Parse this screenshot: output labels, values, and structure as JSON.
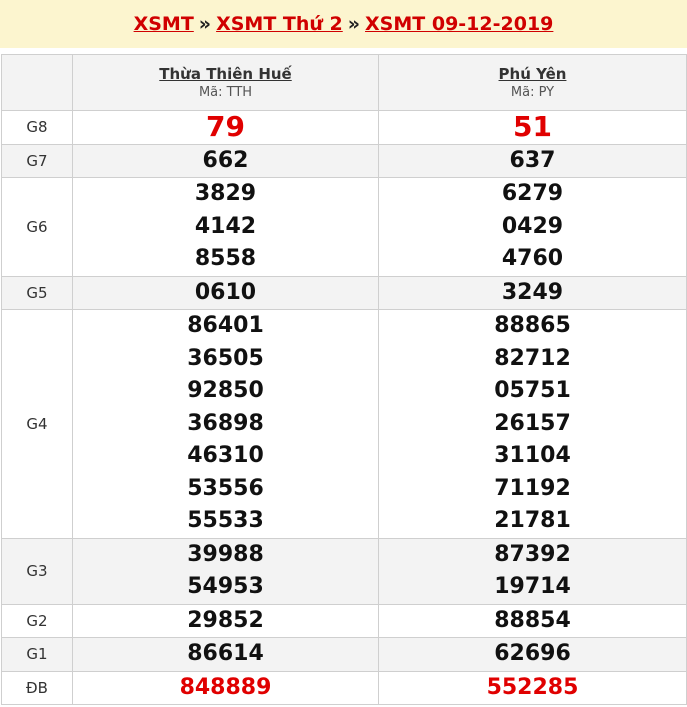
{
  "header": {
    "link1": "XSMT",
    "link2": "XSMT Thứ 2",
    "link3": "XSMT 09-12-2019",
    "separator": "»"
  },
  "provinces": [
    {
      "name": "Thừa Thiên Huế",
      "code": "Mã: TTH"
    },
    {
      "name": "Phú Yên",
      "code": "Mã: PY"
    }
  ],
  "prizes": {
    "g8": {
      "label": "G8",
      "values": [
        [
          "79"
        ],
        [
          "51"
        ]
      ]
    },
    "g7": {
      "label": "G7",
      "values": [
        [
          "662"
        ],
        [
          "637"
        ]
      ]
    },
    "g6": {
      "label": "G6",
      "values": [
        [
          "3829",
          "4142",
          "8558"
        ],
        [
          "6279",
          "0429",
          "4760"
        ]
      ]
    },
    "g5": {
      "label": "G5",
      "values": [
        [
          "0610"
        ],
        [
          "3249"
        ]
      ]
    },
    "g4": {
      "label": "G4",
      "values": [
        [
          "86401",
          "36505",
          "92850",
          "36898",
          "46310",
          "53556",
          "55533"
        ],
        [
          "88865",
          "82712",
          "05751",
          "26157",
          "31104",
          "71192",
          "21781"
        ]
      ]
    },
    "g3": {
      "label": "G3",
      "values": [
        [
          "39988",
          "54953"
        ],
        [
          "87392",
          "19714"
        ]
      ]
    },
    "g2": {
      "label": "G2",
      "values": [
        [
          "29852"
        ],
        [
          "88854"
        ]
      ]
    },
    "g1": {
      "label": "G1",
      "values": [
        [
          "86614"
        ],
        [
          "62696"
        ]
      ]
    },
    "db": {
      "label": "ĐB",
      "values": [
        [
          "848889"
        ],
        [
          "552285"
        ]
      ]
    }
  },
  "colors": {
    "accent": "#e00000",
    "header_bg": "#fcf5cf",
    "row_alt": "#f3f3f3"
  }
}
